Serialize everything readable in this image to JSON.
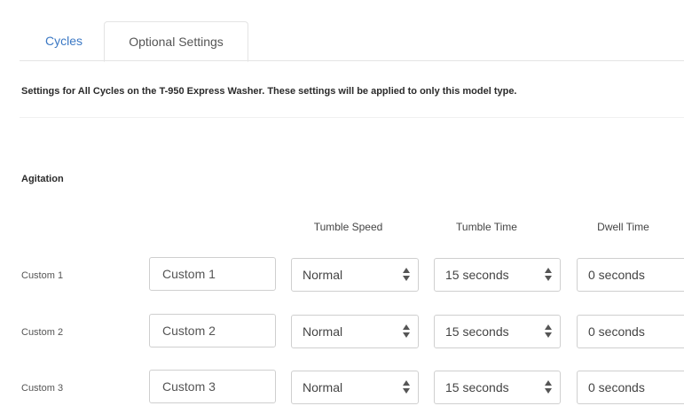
{
  "tabs": [
    {
      "label": "Cycles",
      "active": false
    },
    {
      "label": "Optional Settings",
      "active": true
    }
  ],
  "description": "Settings for All Cycles on the T-950 Express Washer. These settings will be applied to only this model type.",
  "section": {
    "title": "Agitation"
  },
  "columns": {
    "tumble_speed": "Tumble Speed",
    "tumble_time": "Tumble Time",
    "dwell_time": "Dwell Time"
  },
  "rows": [
    {
      "label": "Custom 1",
      "name": "Custom 1",
      "tumble_speed": "Normal",
      "tumble_time": "15 seconds",
      "dwell_time": "0 seconds"
    },
    {
      "label": "Custom 2",
      "name": "Custom 2",
      "tumble_speed": "Normal",
      "tumble_time": "15 seconds",
      "dwell_time": "0 seconds"
    },
    {
      "label": "Custom 3",
      "name": "Custom 3",
      "tumble_speed": "Normal",
      "tumble_time": "15 seconds",
      "dwell_time": "0 seconds"
    }
  ],
  "colors": {
    "accent": "#3b78c4",
    "border": "#cfcfcf"
  },
  "icons": {
    "stepper": "up-down-arrows-icon"
  }
}
